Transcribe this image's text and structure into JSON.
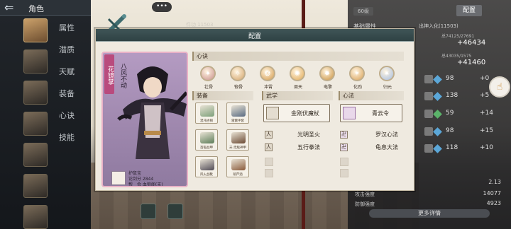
{
  "side": {
    "title": "角色",
    "tabs": [
      "属性",
      "潜质",
      "天赋",
      "装备",
      "心诀",
      "技能"
    ]
  },
  "top_pill": "•••",
  "ghost_text": "件功 11503",
  "right_panel": {
    "level": "60级",
    "config_button": "配置",
    "base_attr_label": "基础属性",
    "bonus_label": "出神入化(11503)",
    "total1": "总74125/27691",
    "val1": "+46434",
    "total2": "总43035/1575",
    "val2": "+41460",
    "stats": [
      {
        "value": "98",
        "plus": "+0"
      },
      {
        "value": "138",
        "plus": "+5"
      },
      {
        "value": "59",
        "plus": "+14"
      },
      {
        "value": "98",
        "plus": "+15"
      },
      {
        "value": "118",
        "plus": "+10"
      }
    ],
    "bottom": [
      {
        "label": "",
        "value": "2.13"
      },
      {
        "label": "攻击强度",
        "value": "14077"
      },
      {
        "label": "防御强度",
        "value": "4923"
      }
    ],
    "more_button": "更多详情"
  },
  "modal": {
    "title": "配置",
    "hero": {
      "name_badge": "花镜掌",
      "title": "八风不动",
      "info": [
        "护鼠宝",
        "论剑分 2844",
        "帮　会 血狼阁(无)"
      ]
    },
    "xinjue_header": "心诀",
    "xinjue": [
      {
        "label": "壮骨",
        "color": "#c98f8c",
        "glyph": "✦"
      },
      {
        "label": "锻骨",
        "color": "#d3a46a",
        "glyph": "✧"
      },
      {
        "label": "冲霄",
        "color": "#d49a4b",
        "glyph": "❂"
      },
      {
        "label": "周天",
        "color": "#e0a956",
        "glyph": "✺"
      },
      {
        "label": "电擎",
        "color": "#c9913e",
        "glyph": "✹"
      },
      {
        "label": "化劲",
        "color": "#d8a158",
        "glyph": "✶"
      },
      {
        "label": "归元",
        "color": "#a6bde0",
        "glyph": "✷"
      }
    ],
    "equip_header": "装备",
    "equip": [
      {
        "label": "混沌古铜",
        "color": "#7da07a"
      },
      {
        "label": "雷震手套",
        "color": "#5a6b82"
      },
      {
        "label": "百锻战甲",
        "color": "#5d7d58"
      },
      {
        "label": "天·无敌神甲",
        "color": "#6b4a33"
      },
      {
        "label": "风火战靴",
        "color": "#4f4a55"
      },
      {
        "label": "葫芦酒",
        "color": "#8a5a3a"
      }
    ],
    "wuxue_header": "武学",
    "wuxue_main": "金刚伏魔杖",
    "wuxue_subs": [
      "光明圣火",
      "五行拳法"
    ],
    "xinfa_header": "心法",
    "xinfa_main": "青云令",
    "xinfa_subs": [
      "罗汉心法",
      "龟息大法"
    ]
  }
}
